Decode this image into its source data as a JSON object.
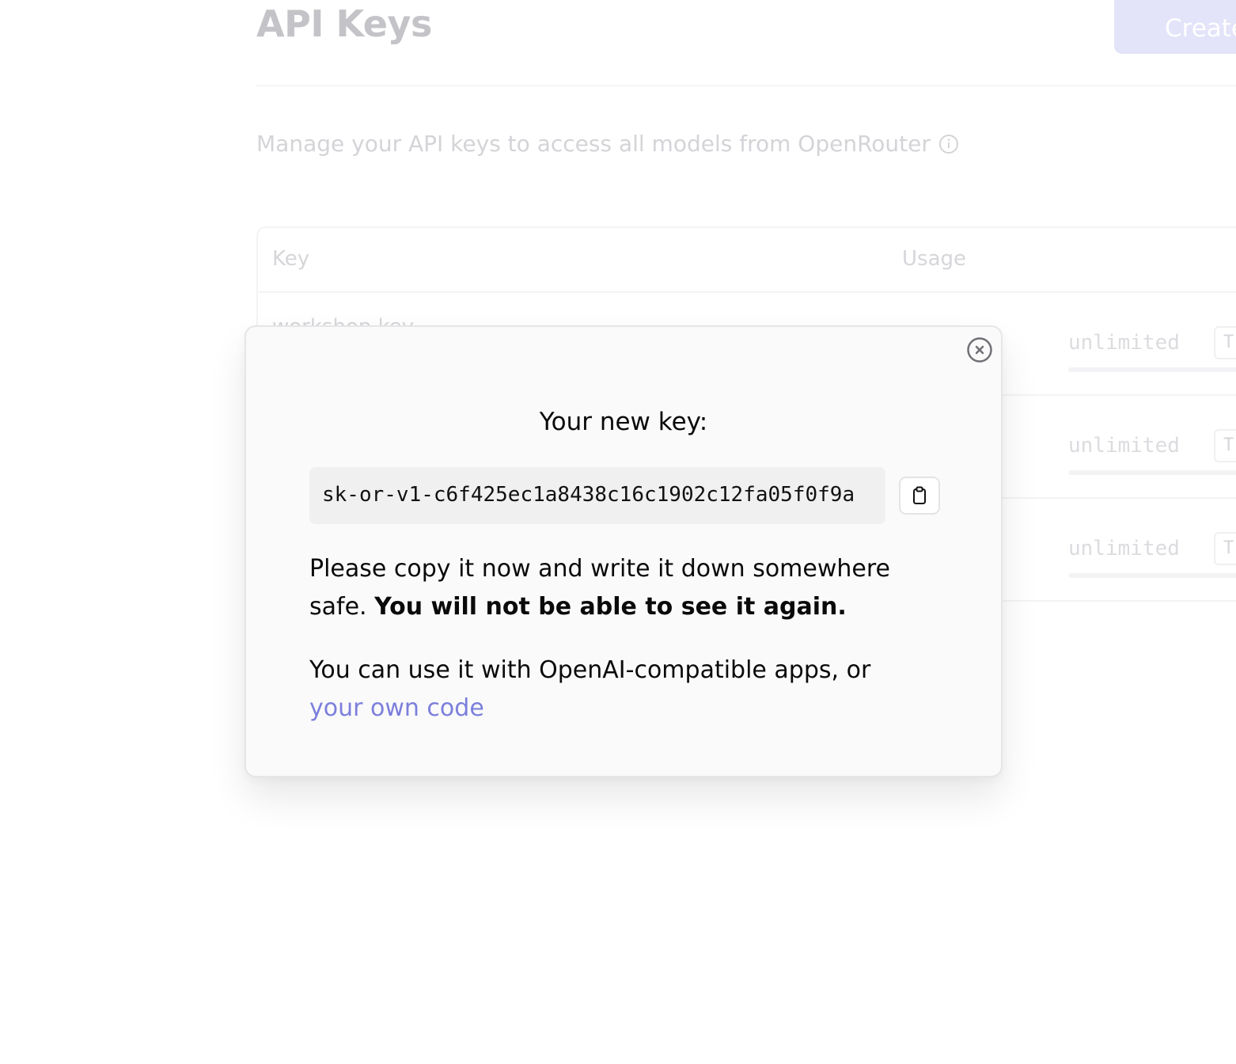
{
  "background": {
    "page_title": "API Keys",
    "create_button_label": "Create",
    "subtitle": "Manage your API keys to access all models from OpenRouter",
    "info_icon": "info-icon",
    "table": {
      "headers": {
        "key": "Key",
        "usage": "Usage"
      },
      "rows": [
        {
          "name": "workshop key",
          "limit": "unlimited",
          "action_glyph": "T"
        },
        {
          "name": "",
          "limit": "unlimited",
          "action_glyph": "T"
        },
        {
          "name": "",
          "limit": "unlimited",
          "action_glyph": "T"
        }
      ]
    }
  },
  "modal": {
    "title": "Your new key:",
    "key_value": "sk-or-v1-c6f425ec1a8438c16c1902c12fa05f0f9a",
    "copy_icon": "clipboard-icon",
    "close_icon": "close-circle-icon",
    "warning_text": "Please copy it now and write it down somewhere safe.",
    "warning_bold": "You will not be able to see it again.",
    "usage_text": "You can use it with OpenAI-compatible apps, or",
    "usage_link": "your own code",
    "link_color": "#7b7fdc"
  },
  "colors": {
    "accent": "#7b7fdc",
    "create_button_bg": "#e3e3f9",
    "modal_bg": "#fafafa"
  }
}
